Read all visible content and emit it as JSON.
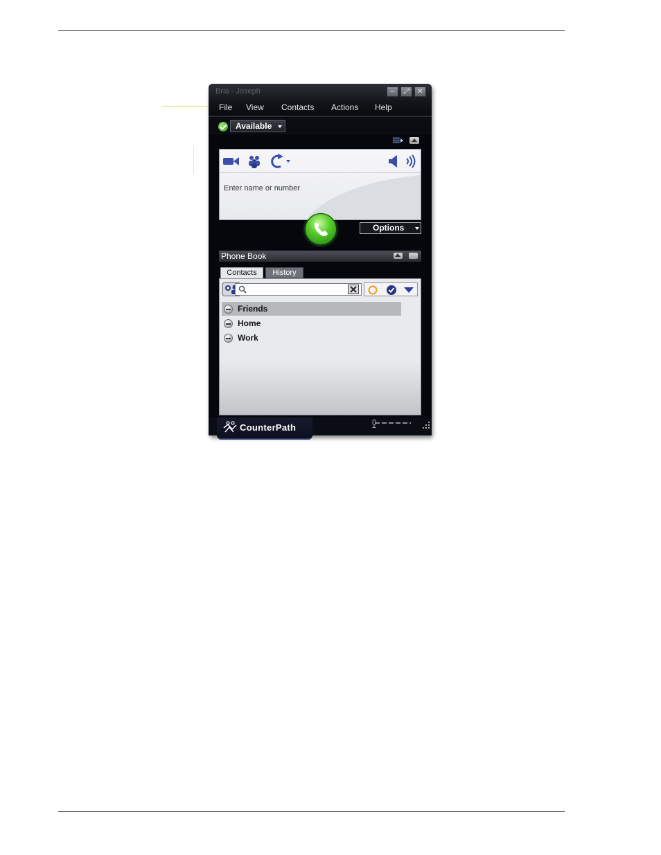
{
  "window": {
    "title": "Bria - Joseph",
    "brand": "CounterPath",
    "window_buttons": [
      "minimize-icon",
      "restore-icon",
      "close-icon"
    ]
  },
  "menu": [
    "File",
    "View",
    "Contacts",
    "Actions",
    "Help"
  ],
  "status": {
    "label": "Available",
    "icon": "check-icon",
    "color": "#3fae1f"
  },
  "dial": {
    "toolbar_icons": [
      "video-camera-icon",
      "conference-icon",
      "redial-icon",
      "speaker-icon",
      "volume-icon"
    ],
    "input_placeholder": "Enter name or number",
    "call_icon": "phone-icon",
    "options_label": "Options"
  },
  "phonebook": {
    "title": "Phone Book",
    "tabs": [
      {
        "label": "Contacts",
        "active": true
      },
      {
        "label": "History",
        "active": false
      }
    ],
    "groups": [
      {
        "label": "Friends",
        "selected": true
      },
      {
        "label": "Home",
        "selected": false
      },
      {
        "label": "Work",
        "selected": false
      }
    ]
  },
  "colors": {
    "window_bg": "#05070d",
    "call_green": "#3fbf1c",
    "accent_blue": "#3b4fa8"
  }
}
